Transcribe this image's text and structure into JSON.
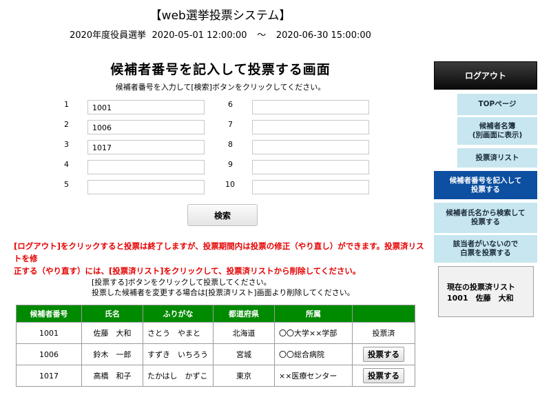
{
  "header": {
    "system_title": "【web選挙投票システム】",
    "election_name": "2020年度役員選挙",
    "start": "2020-05-01 12:00:00",
    "separator": "～",
    "end": "2020-06-30 15:00:00"
  },
  "main": {
    "title": "候補者番号を記入して投票する画面",
    "instruction": "候補者番号を入力して[検索]ボタンをクリックしてください。",
    "inputs": [
      {
        "num": "1",
        "value": "1001"
      },
      {
        "num": "2",
        "value": "1006"
      },
      {
        "num": "3",
        "value": "1017"
      },
      {
        "num": "4",
        "value": ""
      },
      {
        "num": "5",
        "value": ""
      },
      {
        "num": "6",
        "value": ""
      },
      {
        "num": "7",
        "value": ""
      },
      {
        "num": "8",
        "value": ""
      },
      {
        "num": "9",
        "value": ""
      },
      {
        "num": "10",
        "value": ""
      }
    ],
    "search_label": "検索",
    "notice_line1": "[ログアウト]をクリックすると投票は終了しますが、投票期間内は投票の修正（やり直し）ができます。投票済リストを修",
    "notice_line2": "正する（やり直す）には、[投票済リスト]をクリックして、投票済リストから削除してください。",
    "vote_instruction_1": "[投票する]ボタンをクリックして投票してください。",
    "vote_instruction_2": "投票した候補者を変更する場合は[投票済リスト]画面より削除してください。"
  },
  "table": {
    "headers": [
      "候補者番号",
      "氏名",
      "ふりがな",
      "都道府県",
      "所属",
      ""
    ],
    "rows": [
      {
        "id": "1001",
        "name": "佐藤　大和",
        "kana": "さとう　やまと",
        "pref": "北海道",
        "org": "〇〇大学××学部",
        "status": "投票済"
      },
      {
        "id": "1006",
        "name": "鈴木　一郎",
        "kana": "すずき　いちろう",
        "pref": "宮城",
        "org": "〇〇総合病院",
        "action": "投票する"
      },
      {
        "id": "1017",
        "name": "高橋　和子",
        "kana": "たかはし　かずこ",
        "pref": "東京",
        "org": "××医療センター",
        "action": "投票する"
      }
    ]
  },
  "sidebar": {
    "logout": "ログアウト",
    "top": "TOPページ",
    "roster_1": "候補者名簿",
    "roster_2": "(別画面に表示)",
    "voted_list": "投票済リスト",
    "by_number_1": "候補者番号を記入して",
    "by_number_2": "投票する",
    "by_name_1": "候補者氏名から検索して",
    "by_name_2": "投票する",
    "blank_1": "該当者がいないので",
    "blank_2": "白票を投票する",
    "current_title": "現在の投票済リスト",
    "current_item": "1001　佐藤　大和"
  },
  "colors": {
    "table_header": "#008a00",
    "notice": "#e60000",
    "nav_bg": "#c7e6ef",
    "nav_active": "#0d4fa0"
  }
}
